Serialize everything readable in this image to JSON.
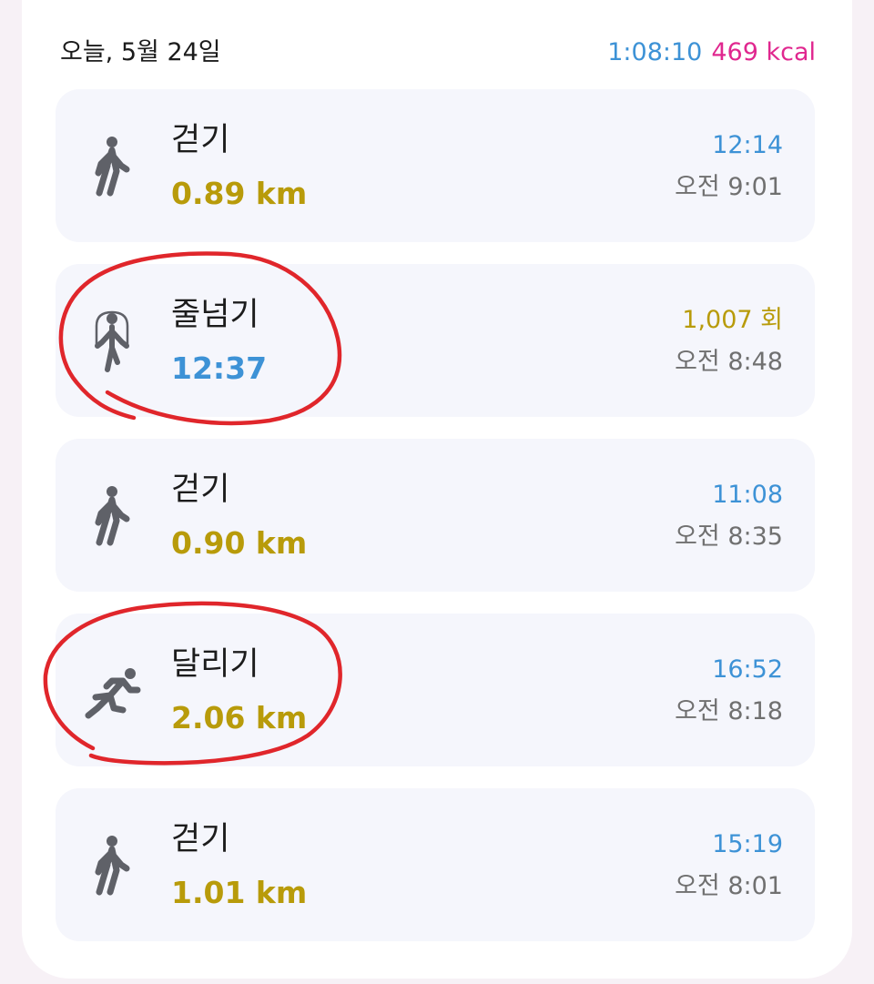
{
  "header": {
    "date": "오늘, 5월 24일",
    "total_duration": "1:08:10",
    "total_kcal": "469 kcal"
  },
  "activities": [
    {
      "icon": "walk-icon",
      "name": "걷기",
      "value": "0.89 km",
      "metric": "12:14",
      "time": "오전 9:01"
    },
    {
      "icon": "jump-rope-icon",
      "name": "줄넘기",
      "value": "12:37",
      "metric": "1,007 회",
      "time": "오전 8:48"
    },
    {
      "icon": "walk-icon",
      "name": "걷기",
      "value": "0.90 km",
      "metric": "11:08",
      "time": "오전 8:35"
    },
    {
      "icon": "run-icon",
      "name": "달리기",
      "value": "2.06 km",
      "metric": "16:52",
      "time": "오전 8:18"
    },
    {
      "icon": "walk-icon",
      "name": "걷기",
      "value": "1.01 km",
      "metric": "15:19",
      "time": "오전 8:01"
    }
  ],
  "colors": {
    "page_background": "#f7f1f6",
    "card_background": "#ffffff",
    "item_background": "#f5f6fc",
    "distance_gold": "#b89b0a",
    "duration_blue": "#3d92d6",
    "kcal_pink": "#e0278f",
    "secondary_gray": "#707070",
    "icon_gray": "#5f6168",
    "annotation_red": "#e0262b"
  }
}
